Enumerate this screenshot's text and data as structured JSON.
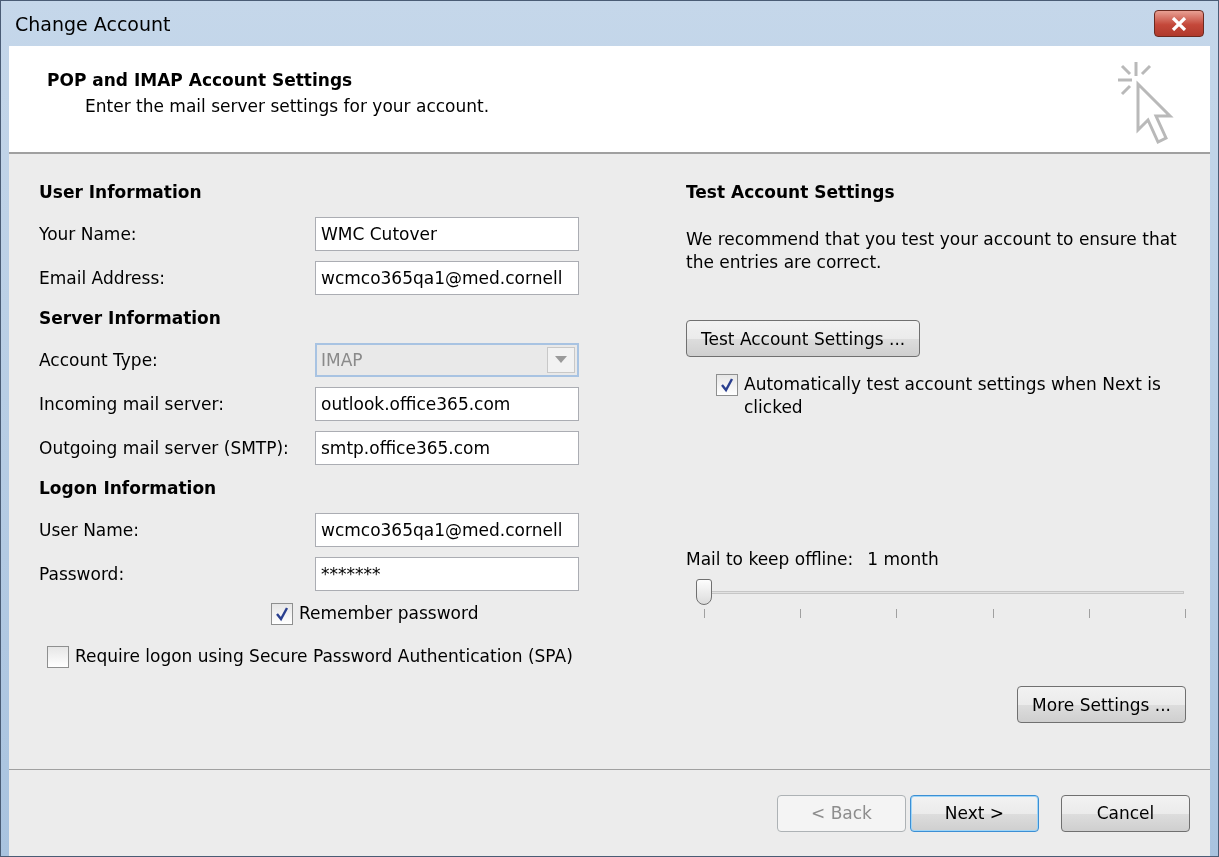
{
  "window": {
    "title": "Change Account"
  },
  "header": {
    "title": "POP and IMAP Account Settings",
    "subtitle": "Enter the mail server settings for your account."
  },
  "sections": [
    {
      "heading": "User Information",
      "fields": [
        {
          "label": "Your Name:",
          "kind": "text",
          "value": "WMC Cutover"
        },
        {
          "label": "Email Address:",
          "kind": "text",
          "value": "wcmco365qa1@med.cornell"
        }
      ]
    },
    {
      "heading": "Server Information",
      "fields": [
        {
          "label": "Account Type:",
          "kind": "dropdown",
          "value": "IMAP",
          "disabled": true
        },
        {
          "label": "Incoming mail server:",
          "kind": "text",
          "value": "outlook.office365.com"
        },
        {
          "label": "Outgoing mail server (SMTP):",
          "kind": "text",
          "value": "smtp.office365.com"
        }
      ]
    },
    {
      "heading": "Logon Information",
      "fields": [
        {
          "label": "User Name:",
          "kind": "text",
          "value": "wcmco365qa1@med.cornell"
        },
        {
          "label": "Password:",
          "kind": "password",
          "value": "*******"
        }
      ]
    }
  ],
  "remember_password": {
    "label": "Remember password",
    "checked": true
  },
  "spa": {
    "label": "Require logon using Secure Password Authentication (SPA)",
    "checked": false
  },
  "test": {
    "heading": "Test Account Settings",
    "description": "We recommend that you test your account to ensure that the entries are correct.",
    "button": "Test Account Settings ...",
    "auto_test": {
      "label": "Automatically test account settings when Next is clicked",
      "checked": true
    }
  },
  "offline": {
    "label": "Mail to keep offline:",
    "value": "1 month",
    "level": 0
  },
  "more_settings": "More Settings ...",
  "buttons": [
    {
      "label": "< Back",
      "disabled": true,
      "default": false
    },
    {
      "label": "Next >",
      "disabled": false,
      "default": true
    },
    {
      "label": "Cancel",
      "disabled": false,
      "default": false
    }
  ]
}
